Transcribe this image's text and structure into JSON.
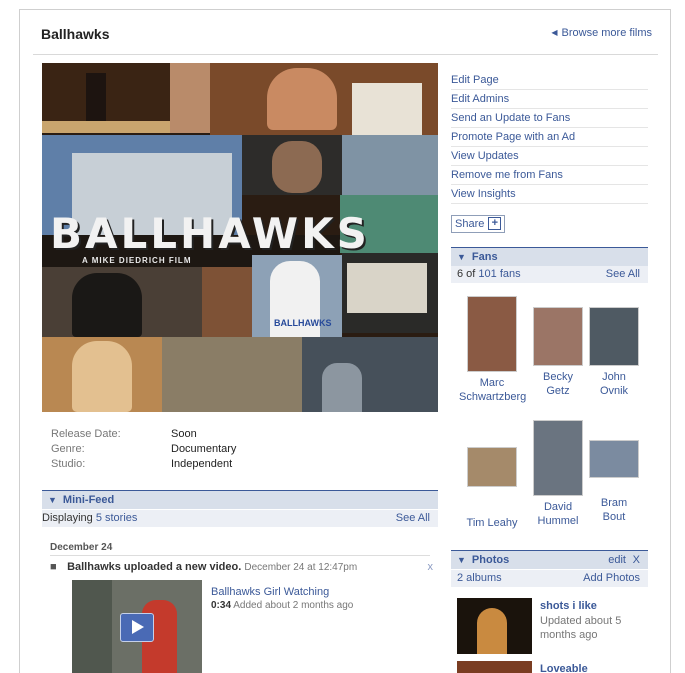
{
  "header": {
    "title": "Ballhawks",
    "browse_link": "Browse more films"
  },
  "poster": {
    "title": "BALLHAWKS",
    "subtitle": "A MIKE DIEDRICH FILM",
    "shirt_text": "BALLHAWKS"
  },
  "info": [
    {
      "label": "Release Date:",
      "value": "Soon"
    },
    {
      "label": "Genre:",
      "value": "Documentary"
    },
    {
      "label": "Studio:",
      "value": "Independent"
    }
  ],
  "actions": [
    "Edit Page",
    "Edit Admins",
    "Send an Update to Fans",
    "Promote Page with an Ad",
    "View Updates",
    "Remove me from Fans",
    "View Insights"
  ],
  "share": {
    "label": "Share",
    "plus": "+"
  },
  "fans": {
    "title": "Fans",
    "count_prefix": "6 of",
    "count_link": "101 fans",
    "see_all": "See All",
    "people": [
      {
        "first": "Marc",
        "last": "Schwartzberg"
      },
      {
        "first": "Becky",
        "last": "Getz"
      },
      {
        "first": "John",
        "last": "Ovnik"
      },
      {
        "first": "Tim Leahy",
        "last": ""
      },
      {
        "first": "David",
        "last": "Hummel"
      },
      {
        "first": "Bram",
        "last": "Bout"
      }
    ]
  },
  "minifeed": {
    "title": "Mini-Feed",
    "displaying": "Displaying",
    "stories_link": "5 stories",
    "see_all": "See All",
    "date": "December 24",
    "story_text": "Ballhawks uploaded a new video.",
    "story_time": "December 24 at 12:47pm",
    "close": "x",
    "video_title": "Ballhawks Girl Watching",
    "video_duration": "0:34",
    "video_added": "Added about 2 months ago"
  },
  "photos": {
    "title": "Photos",
    "edit": "edit",
    "close": "X",
    "albums_count": "2 albums",
    "add_photos": "Add Photos",
    "album1_title": "shots i like",
    "album1_updated": "Updated about 5 months ago",
    "album2_title": "Loveable"
  },
  "colors": {
    "link": "#3b5998",
    "section_bg": "#d8dfea",
    "sub_bg": "#eceff5"
  }
}
